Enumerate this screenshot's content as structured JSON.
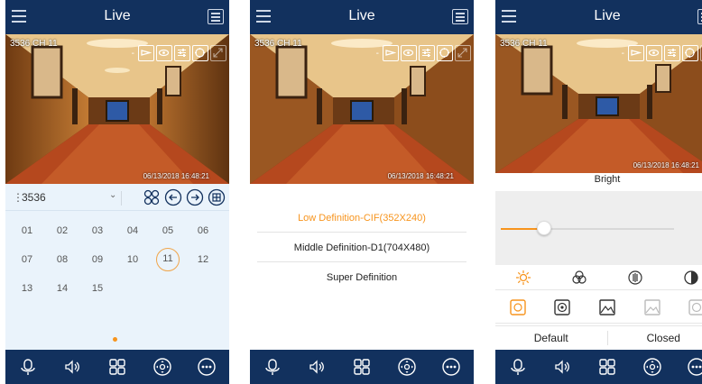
{
  "screen_title": "Live",
  "camera_label": "3536  CH 11",
  "camera_label_short": "3536  CH 11",
  "timestamp": "06/13/2018 16:48:21",
  "overlay_dash": "-",
  "device_selector": {
    "value": "3536"
  },
  "channels": [
    "01",
    "02",
    "03",
    "04",
    "05",
    "06",
    "07",
    "08",
    "09",
    "10",
    "11",
    "12",
    "13",
    "14",
    "15"
  ],
  "selected_channel": "11",
  "definitions": [
    {
      "label": "Low Definition-CIF(352X240)",
      "active": true
    },
    {
      "label": "Middle Definition-D1(704X480)",
      "active": false
    },
    {
      "label": "Super Definition",
      "active": false
    }
  ],
  "image_settings": {
    "title": "Bright",
    "value": 25,
    "max": 100,
    "default_label": "Default",
    "closed_label": "Closed"
  },
  "colors": {
    "navy": "#12315e",
    "accent": "#f7941d",
    "panel_bg": "#eaf3fb"
  },
  "icons": {
    "top": [
      "menu-icon",
      "layout-icon"
    ],
    "overlay": [
      "snapshot-icon",
      "eye-icon",
      "sliders-icon",
      "ptz-icon",
      "fullscreen-icon"
    ],
    "selector_tools": [
      "split-screen-icon",
      "previous-icon",
      "next-icon",
      "grid-icon"
    ],
    "bottom": [
      "talk-icon",
      "speaker-icon",
      "windows-icon",
      "ptz-control-icon",
      "more-icon"
    ],
    "adjust": [
      "brightness-icon",
      "color-icon",
      "contrast-icon",
      "saturation-icon"
    ],
    "scene_modes": [
      "auto-mode-icon",
      "indoor-mode-icon",
      "outdoor-mode-icon",
      "night-mode-icon",
      "custom-mode-icon"
    ]
  }
}
